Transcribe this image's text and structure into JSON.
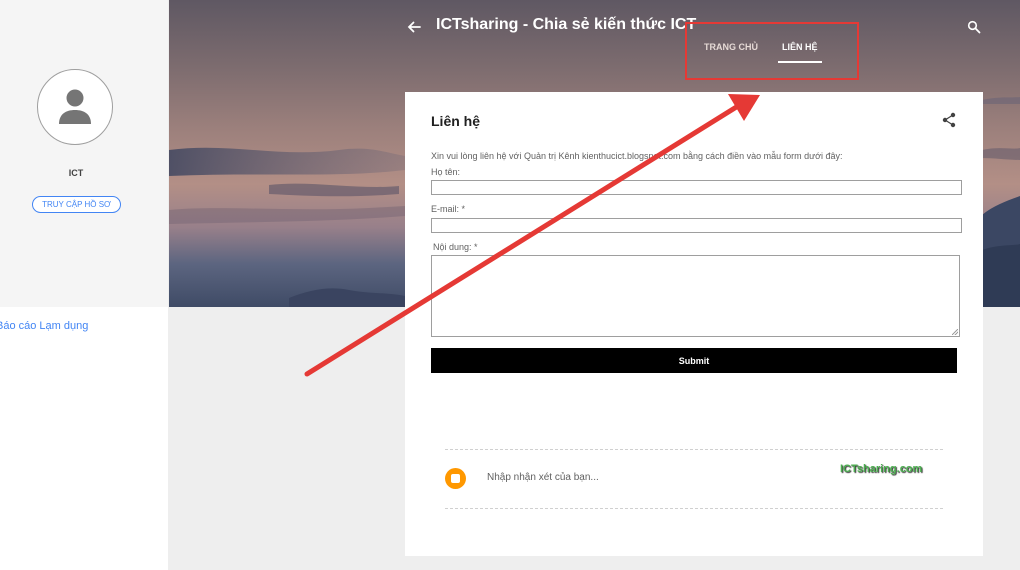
{
  "profile": {
    "name": "ICT",
    "visit_profile_label": "TRUY CẬP HỒ SƠ"
  },
  "sidebar": {
    "report_abuse": "Báo cáo Lạm dụng"
  },
  "header": {
    "title": "ICTsharing - Chia sẻ kiến thức ICT",
    "back_icon": "arrow-left-icon",
    "search_icon": "search-icon"
  },
  "nav": {
    "tabs": [
      {
        "label": "TRANG CHỦ",
        "active": false
      },
      {
        "label": "LIÊN HỆ",
        "active": true
      }
    ]
  },
  "post": {
    "title": "Liên hệ",
    "share_icon": "share-icon",
    "intro": "Xin vui lòng liên hệ với Quản trị Kênh kienthucict.blogspot.com bằng cách điền vào mẫu form dưới đây:",
    "form": {
      "name_label": "Họ tên:",
      "name_value": "",
      "email_label": "E-mail: *",
      "email_value": "",
      "message_label": "Nội dung: *",
      "message_value": "",
      "submit_label": "Submit"
    }
  },
  "comments": {
    "placeholder": "Nhập nhận xét của bạn...",
    "watermark": "ICTsharing.com"
  },
  "colors": {
    "accent": "#4285f4",
    "annotation": "#e53935",
    "blogger_orange": "#ff9800",
    "submit_bg": "#000000"
  }
}
